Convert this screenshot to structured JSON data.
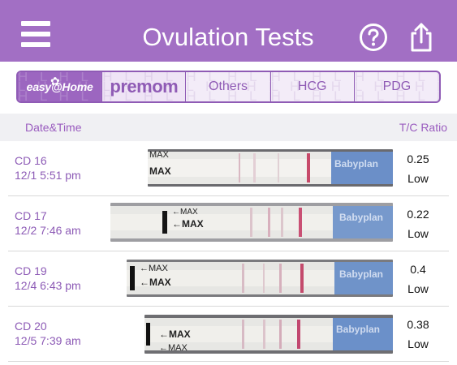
{
  "header": {
    "title": "Ovulation Tests",
    "menu_icon": "hamburger-menu-icon",
    "help_icon": "question-circle-icon",
    "share_icon": "share-upload-icon",
    "background_color": "#a26fc4"
  },
  "brand_tabs": [
    {
      "label": "easy@Home",
      "selected": false
    },
    {
      "label": "premom",
      "selected": true
    },
    {
      "label": "Others"
    },
    {
      "label": "HCG"
    },
    {
      "label": "PDG"
    }
  ],
  "table": {
    "columns": [
      "Date&Time",
      "T/C Ratio"
    ],
    "rows": [
      {
        "cycle_day": "CD 16",
        "datetime": "12/1 5:51 pm",
        "ratio": "0.25",
        "level": "Low",
        "strip": {
          "marker": "MAX",
          "brand": "Babyplan"
        }
      },
      {
        "cycle_day": "CD 17",
        "datetime": "12/2 7:46 am",
        "ratio": "0.22",
        "level": "Low",
        "strip": {
          "marker": "MAX",
          "brand": "Babyplan"
        }
      },
      {
        "cycle_day": "CD 19",
        "datetime": "12/4 6:43 pm",
        "ratio": "0.4",
        "level": "Low",
        "strip": {
          "marker": "MAX",
          "brand": "Babyplan"
        }
      },
      {
        "cycle_day": "CD 20",
        "datetime": "12/5 7:39 am",
        "ratio": "0.38",
        "level": "Low",
        "strip": {
          "marker": "MAX",
          "brand": "Babyplan"
        }
      }
    ]
  },
  "colors": {
    "accent": "#a26fc4",
    "label_purple": "#8d5bb6",
    "strip_line": "#c74a6a",
    "strip_brand_blue": "#4f7fc2"
  }
}
